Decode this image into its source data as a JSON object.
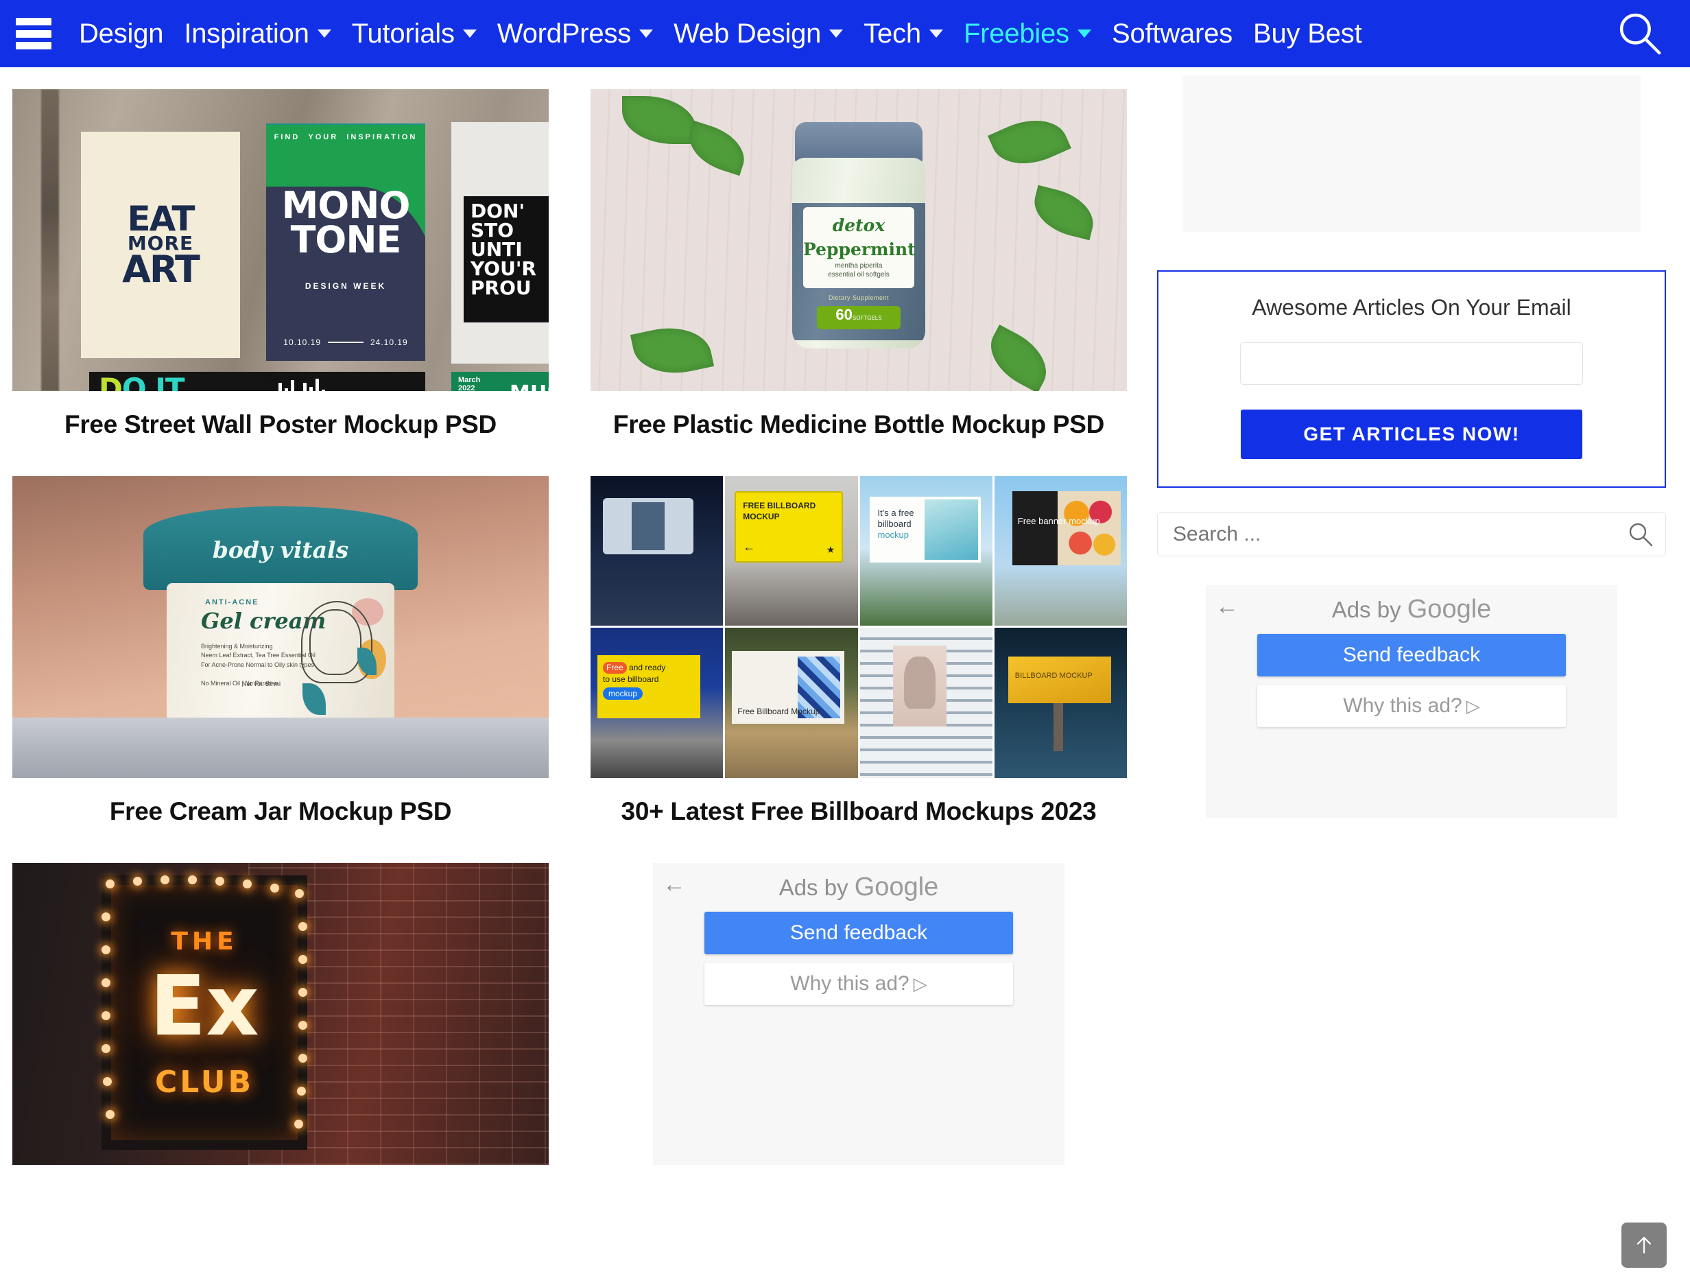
{
  "navbar": {
    "menu_icon": "hamburger-icon",
    "search_icon": "search-icon",
    "accent_color": "#1230E6",
    "active_color": "#35F2F2",
    "items": [
      {
        "label": "Design",
        "has_dropdown": false,
        "active": false
      },
      {
        "label": "Inspiration",
        "has_dropdown": true,
        "active": false
      },
      {
        "label": "Tutorials",
        "has_dropdown": true,
        "active": false
      },
      {
        "label": "WordPress",
        "has_dropdown": true,
        "active": false
      },
      {
        "label": "Web Design",
        "has_dropdown": true,
        "active": false
      },
      {
        "label": "Tech",
        "has_dropdown": true,
        "active": false
      },
      {
        "label": "Freebies",
        "has_dropdown": true,
        "active": true
      },
      {
        "label": "Softwares",
        "has_dropdown": false,
        "active": false
      },
      {
        "label": "Buy Best",
        "has_dropdown": false,
        "active": false
      }
    ]
  },
  "posts": [
    {
      "title": "Free Street Wall Poster Mockup PSD",
      "image_alt": "street-wall-posters",
      "image_text": {
        "poster1": [
          "EAT",
          "MORE",
          "ART"
        ],
        "poster2_top": "FIND   YOUR   INSPIRATION",
        "poster2_title": [
          "MONO",
          "TONE"
        ],
        "poster2_sub": "DESIGN WEEK",
        "poster2_date_start": "10.10.19",
        "poster2_date_end": "24.10.19",
        "poster3": [
          "DON'T",
          "STOP",
          "UNTIL",
          "YOU'R",
          "PROUD"
        ],
        "poster4": "DO IT",
        "poster6_month": "March",
        "poster6_year": "2022",
        "poster6_title": "MUSIC"
      }
    },
    {
      "title": "Free Plastic Medicine Bottle Mockup PSD",
      "image_alt": "plastic-medicine-bottle",
      "image_text": {
        "brand": "detox",
        "product": "Peppermint",
        "subtitle_1": "mentha piperita",
        "subtitle_2": "essential oil softgels",
        "category": "Dietary Supplement",
        "count": "60",
        "count_unit": "SOFTGELS"
      }
    },
    {
      "title": "Free Cream Jar Mockup PSD",
      "image_alt": "cream-jar",
      "image_text": {
        "brand": "body vitals",
        "kicker": "ANTI-ACNE",
        "product": "Gel cream",
        "line1": "Brightening & Moisturizing",
        "line2": "Neem Leaf Extract, Tea Tree Essential Oil",
        "line3": "For Acne-Prone Normal to Oily skin types",
        "line4": "No Mineral Oil | No Paraben",
        "volume": "Net Vol. 50 ml"
      }
    },
    {
      "title": "30+ Latest Free Billboard Mockups 2023",
      "image_alt": "billboard-mockups-collage",
      "image_text": {
        "tile2": "FREE BILLBOARD MOCKUP",
        "tile3a": "It's a free",
        "tile3b": "billboard",
        "tile3c": "mockup",
        "tile4": "Free banner mockup",
        "tile5a": "Free",
        "tile5b": "and ready",
        "tile5c": "to use billboard",
        "tile5d": "mockup",
        "tile6": "Free Billboard Mockup",
        "tile8": "BILLBOARD MOCKUP"
      }
    },
    {
      "title": "",
      "image_alt": "the-ex-club-neon-sign",
      "image_text": {
        "line1": "THE",
        "line2": "Ex",
        "line3": "CLUB"
      }
    }
  ],
  "center_ad": {
    "back_icon": "back-arrow-icon",
    "header_prefix": "Ads by ",
    "header_brand": "Google",
    "feedback_label": "Send feedback",
    "why_label": "Why this ad?",
    "why_icon": "adchoices-icon",
    "button_color": "#4285F4"
  },
  "sidebar": {
    "ad_placeholder_label": "",
    "email_widget": {
      "title": "Awesome Articles On Your Email",
      "input_value": "",
      "input_placeholder": "",
      "button_label": "GET ARTICLES NOW!",
      "border_color": "#1230E6"
    },
    "search": {
      "value": "",
      "placeholder": "Search ...",
      "icon": "search-icon"
    },
    "ad": {
      "back_icon": "back-arrow-icon",
      "header_prefix": "Ads by ",
      "header_brand": "Google",
      "feedback_label": "Send feedback",
      "why_label": "Why this ad?",
      "why_icon": "adchoices-icon"
    }
  },
  "scroll_top": {
    "icon": "arrow-up-icon",
    "label": ""
  }
}
